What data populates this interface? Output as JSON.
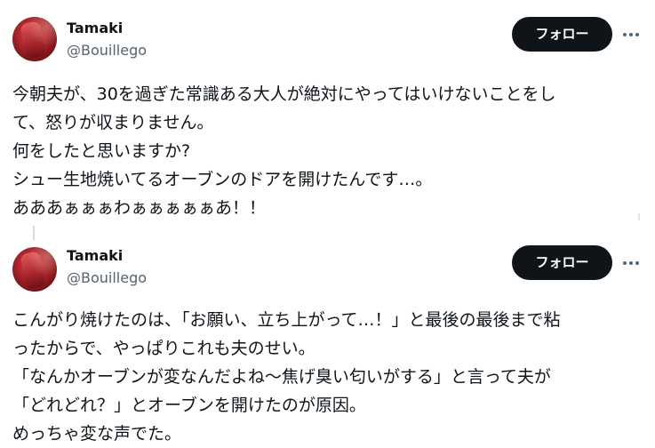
{
  "tweets": [
    {
      "author": {
        "name": "Tamaki",
        "handle": "@Bouillego"
      },
      "follow_label": "フォロー",
      "more_icon": "more-horizontal-icon",
      "text_lines": [
        "今朝夫が、30を過ぎた常識ある大人が絶対にやってはいけないことをし",
        "て、怒りが収まりません。",
        "何をしたと思いますか?",
        "シュー生地焼いてるオーブンのドアを開けたんです…。",
        "あああぁぁぁわぁぁぁぁぁあ！！"
      ]
    },
    {
      "author": {
        "name": "Tamaki",
        "handle": "@Bouillego"
      },
      "follow_label": "フォロー",
      "more_icon": "more-horizontal-icon",
      "text_lines": [
        "こんがり焼けたのは、「お願い、立ち上がって…！」と最後の最後まで粘",
        "ったからで、やっぱりこれも夫のせい。",
        "「なんかオーブンが変なんだよね〜焦げ臭い匂いがする」と言って夫が",
        "「どれどれ？」とオーブンを開けたのが原因。",
        "めっちゃ変な声でた。"
      ]
    }
  ],
  "colors": {
    "text": "#0f1419",
    "secondary_text": "#536471",
    "button_bg": "#0f1419",
    "button_text": "#ffffff",
    "thread_line": "#cfd9de"
  }
}
